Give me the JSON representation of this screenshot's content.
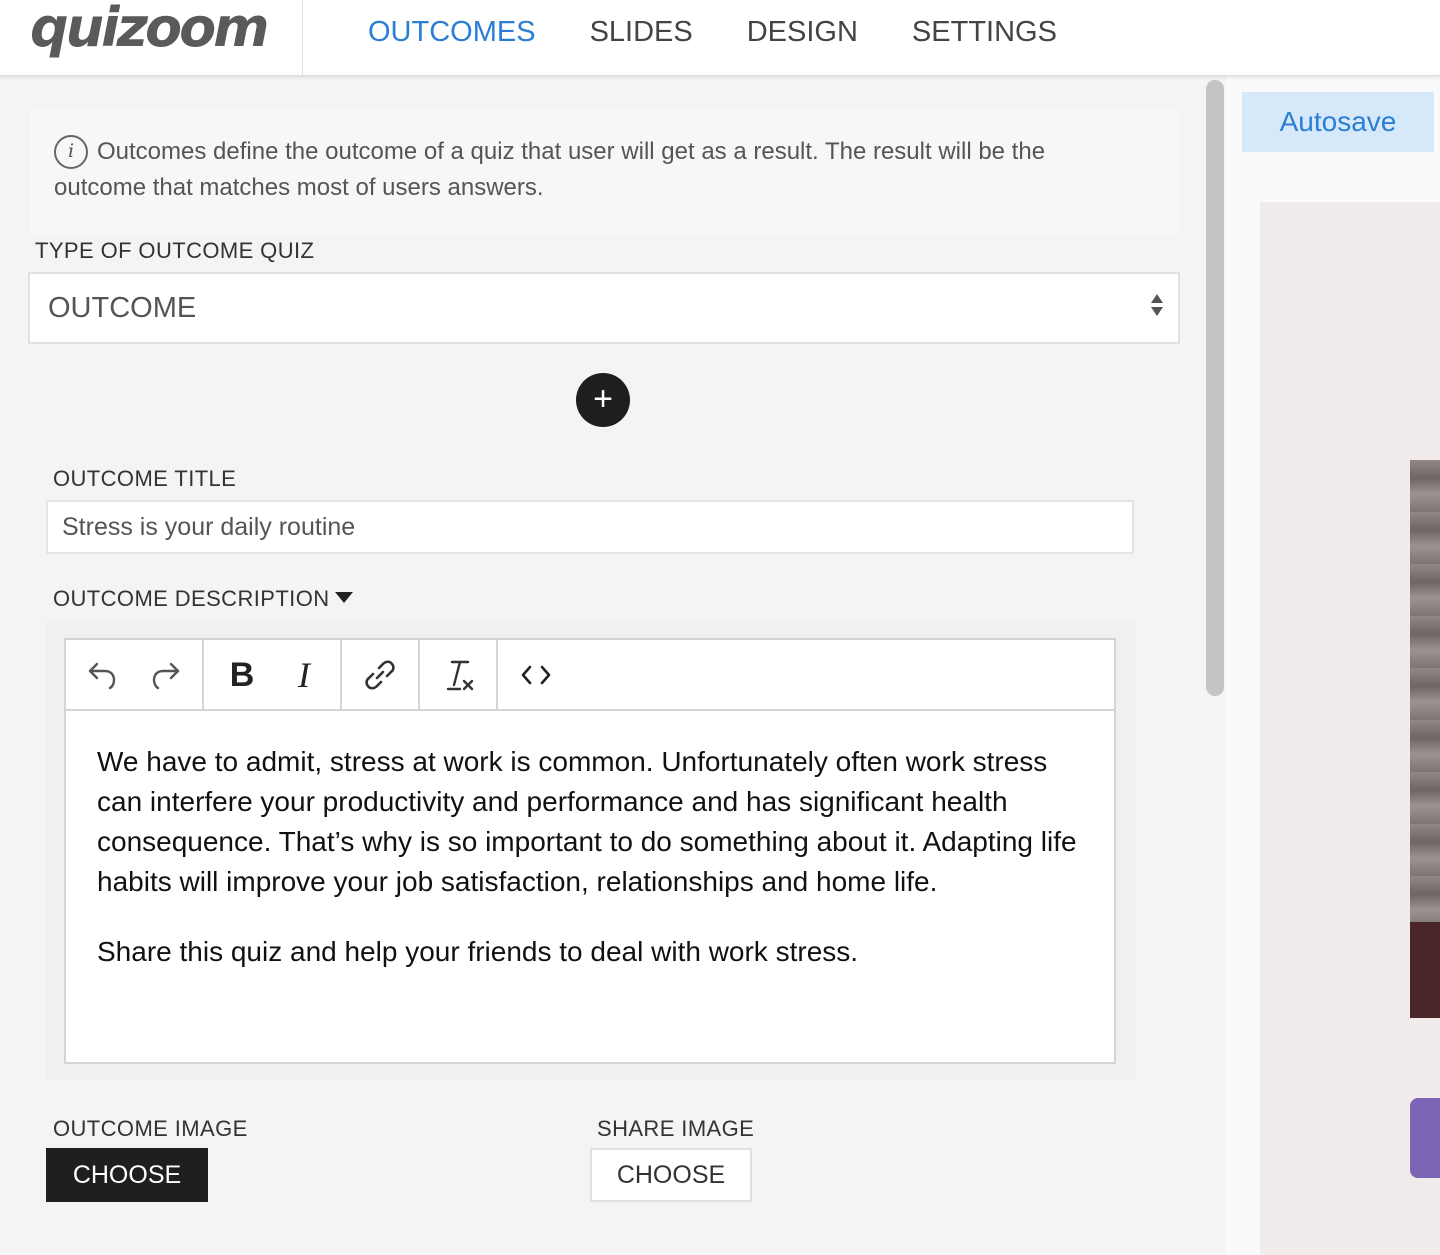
{
  "header": {
    "logo": "quizoom",
    "tabs": [
      {
        "label": "OUTCOMES",
        "active": true
      },
      {
        "label": "SLIDES",
        "active": false
      },
      {
        "label": "DESIGN",
        "active": false
      },
      {
        "label": "SETTINGS",
        "active": false
      }
    ]
  },
  "info": {
    "icon": "info-icon",
    "glyph": "i",
    "text": "Outcomes define the outcome of a quiz that user will get as a result. The result will be the outcome that matches most of users answers."
  },
  "quiz_type": {
    "label": "TYPE OF OUTCOME QUIZ",
    "value": "OUTCOME"
  },
  "add_button": {
    "glyph": "+"
  },
  "outcome": {
    "title_label": "OUTCOME TITLE",
    "title_value": "Stress is your daily routine",
    "description_label": "OUTCOME DESCRIPTION",
    "toolbar": {
      "bold": "B",
      "italic": "I"
    },
    "description_paragraphs": [
      "We have to admit, stress at work is common. Unfortunately often work stress can interfere your productivity and performance and has significant health consequence. That’s why is so important to do something about it.  Adapting life habits will improve your job satisfaction, relationships and home life.",
      "Share this quiz and help your friends to deal with work stress."
    ],
    "image_label": "OUTCOME IMAGE",
    "image_button": "CHOOSE",
    "share_label": "SHARE IMAGE",
    "share_button": "CHOOSE"
  },
  "autosave": "Autosave",
  "colors": {
    "accent": "#2a7fd4",
    "autosave_bg": "#d6e9fb",
    "dark_button": "#1f1f1f",
    "preview_button": "#7b65b5"
  }
}
